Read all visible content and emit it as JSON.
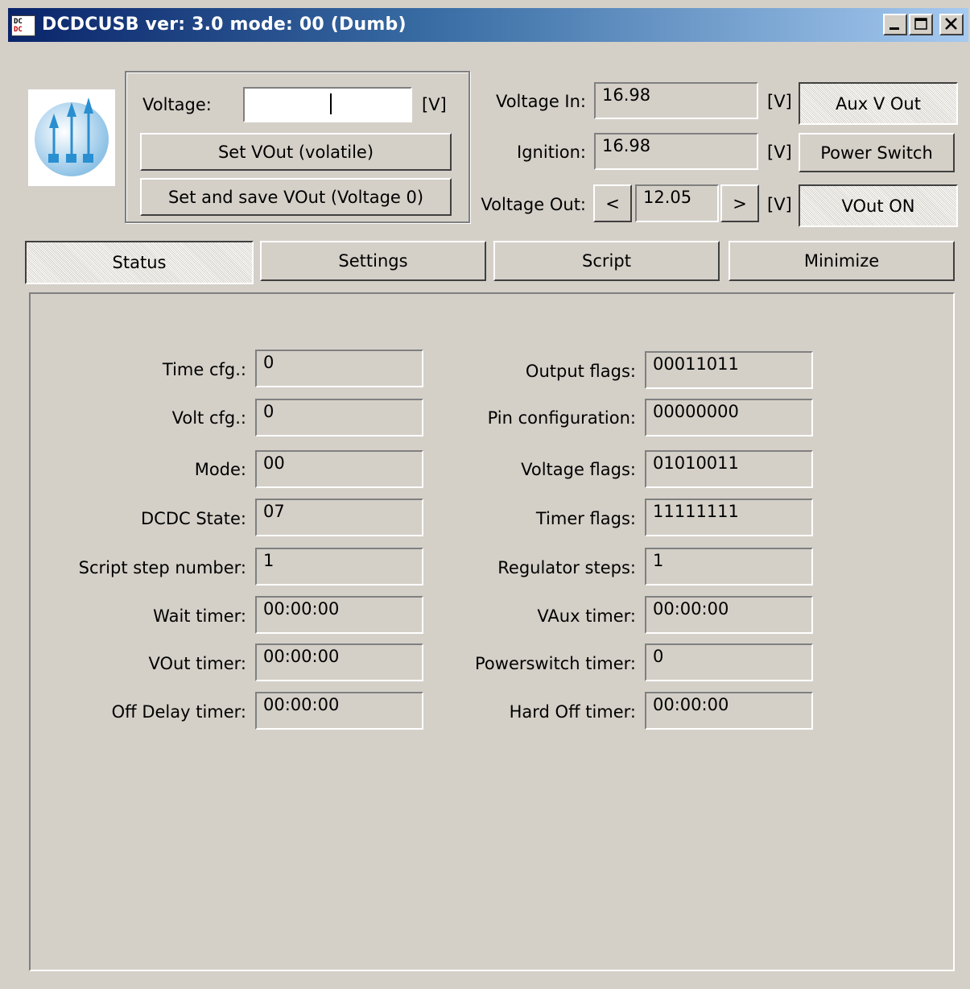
{
  "window": {
    "title": "DCDCUSB ver: 3.0 mode: 00 (Dumb)",
    "app_icon_lines": [
      "DC",
      "DC"
    ],
    "controls": [
      "minimize-icon",
      "maximize-icon",
      "close-icon"
    ]
  },
  "voltage_group": {
    "voltage_label": "Voltage:",
    "voltage_value": "",
    "unit": "[V]",
    "set_vout_label": "Set VOut (volatile)",
    "set_save_label": "Set and save VOut (Voltage 0)"
  },
  "readings": {
    "voltage_in_label": "Voltage In:",
    "voltage_in_value": "16.98",
    "ignition_label": "Ignition:",
    "ignition_value": "16.98",
    "voltage_out_label": "Voltage Out:",
    "voltage_out_value": "12.05",
    "decrease_label": "<",
    "increase_label": ">",
    "unit": "[V]"
  },
  "toggles": {
    "aux_v_out": "Aux V Out",
    "power_switch": "Power Switch",
    "vout_on": "VOut ON"
  },
  "tabs": [
    {
      "label": "Status",
      "active": true
    },
    {
      "label": "Settings",
      "active": false
    },
    {
      "label": "Script",
      "active": false
    },
    {
      "label": "Minimize",
      "active": false
    }
  ],
  "status": {
    "left": [
      {
        "label": "Time cfg.:",
        "value": "0"
      },
      {
        "label": "Volt cfg.:",
        "value": "0"
      },
      {
        "label": "Mode:",
        "value": "00"
      },
      {
        "label": "DCDC State:",
        "value": "07"
      },
      {
        "label": "Script step number:",
        "value": "1"
      },
      {
        "label": "Wait timer:",
        "value": "00:00:00"
      },
      {
        "label": "VOut timer:",
        "value": "00:00:00"
      },
      {
        "label": "Off Delay timer:",
        "value": "00:00:00"
      }
    ],
    "right": [
      {
        "label": "Output flags:",
        "value": "00011011"
      },
      {
        "label": "Pin configuration:",
        "value": "00000000"
      },
      {
        "label": "Voltage flags:",
        "value": "01010011"
      },
      {
        "label": "Timer flags:",
        "value": "11111111"
      },
      {
        "label": "Regulator steps:",
        "value": "1"
      },
      {
        "label": "VAux timer:",
        "value": "00:00:00"
      },
      {
        "label": "Powerswitch timer:",
        "value": "0"
      },
      {
        "label": "Hard Off timer:",
        "value": "00:00:00"
      }
    ]
  },
  "colors": {
    "face": "#d4d0c8",
    "title_start": "#0a246a",
    "title_end": "#a6caf0",
    "logo_blue": "#1e88c8",
    "logo_light": "#b8d8f0"
  }
}
